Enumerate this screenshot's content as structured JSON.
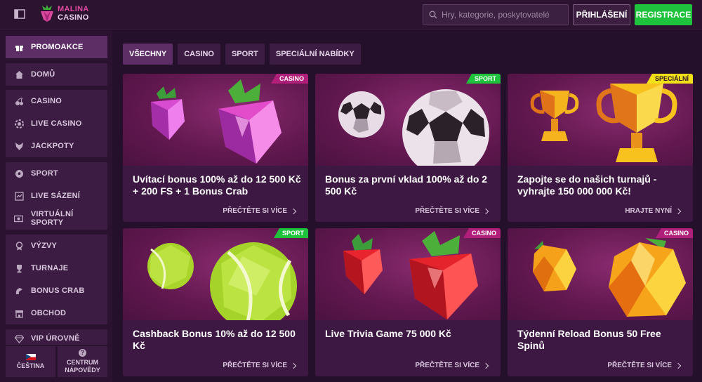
{
  "header": {
    "logo_line1": "MALINA",
    "logo_line2": "CASINO",
    "search_placeholder": "Hry, kategorie, poskytovatelé",
    "login_label": "PŘIHLÁŠENÍ",
    "register_label": "REGISTRACE"
  },
  "sidebar": {
    "groups": [
      {
        "items": [
          {
            "label": "PROMOAKCE",
            "icon": "gift-icon"
          }
        ]
      },
      {
        "items": [
          {
            "label": "DOMŮ",
            "icon": "home-icon"
          }
        ]
      },
      {
        "items": [
          {
            "label": "CASINO",
            "icon": "cherries-icon"
          },
          {
            "label": "LIVE CASINO",
            "icon": "chip-icon"
          },
          {
            "label": "JACKPOTY",
            "icon": "wolf-icon"
          }
        ]
      },
      {
        "items": [
          {
            "label": "SPORT",
            "icon": "soccer-ball-icon"
          },
          {
            "label": "LIVE SÁZENÍ",
            "icon": "live-betting-icon"
          },
          {
            "label": "VIRTUÁLNÍ SPORTY",
            "icon": "virtual-sports-icon"
          }
        ]
      },
      {
        "items": [
          {
            "label": "VÝZVY",
            "icon": "medal-icon"
          },
          {
            "label": "TURNAJE",
            "icon": "trophy-icon"
          },
          {
            "label": "BONUS CRAB",
            "icon": "claw-icon"
          },
          {
            "label": "OBCHOD",
            "icon": "shop-icon"
          }
        ]
      },
      {
        "items": [
          {
            "label": "VIP ÚROVNĚ",
            "icon": "diamond-icon"
          }
        ]
      }
    ],
    "language_label": "ČEŠTINA",
    "help_line1": "CENTRUM",
    "help_line2": "NÁPOVĚDY"
  },
  "tabs": [
    {
      "label": "VŠECHNY",
      "active": true
    },
    {
      "label": "CASINO",
      "active": false
    },
    {
      "label": "SPORT",
      "active": false
    },
    {
      "label": "SPECIÁLNÍ NABÍDKY",
      "active": false
    }
  ],
  "promos": [
    {
      "badge": "CASINO",
      "badge_type": "casino",
      "title": "Uvítací bonus 100% až do 12 500 Kč + 200 FS + 1 Bonus Crab",
      "cta": "PŘEČTĚTE SI VÍCE",
      "art": "raspberry"
    },
    {
      "badge": "SPORT",
      "badge_type": "sport",
      "title": "Bonus za první vklad 100% až do 2 500 Kč",
      "cta": "PŘEČTĚTE SI VÍCE",
      "art": "soccer"
    },
    {
      "badge": "SPECIÁLNÍ",
      "badge_type": "special",
      "title": "Zapojte se do našich turnajů - vyhrajte 150 000 000 Kč!",
      "cta": "HRAJTE NYNÍ",
      "art": "trophy"
    },
    {
      "badge": "SPORT",
      "badge_type": "sport",
      "title": "Cashback Bonus 10% až do 12 500 Kč",
      "cta": "PŘEČTĚTE SI VÍCE",
      "art": "tennis"
    },
    {
      "badge": "CASINO",
      "badge_type": "casino",
      "title": "Live Trivia Game 75 000 Kč",
      "cta": "PŘEČTĚTE SI VÍCE",
      "art": "strawberry"
    },
    {
      "badge": "CASINO",
      "badge_type": "casino",
      "title": "Týdenní Reload Bonus 50 Free Spinů",
      "cta": "PŘEČTĚTE SI VÍCE",
      "art": "lemon"
    }
  ]
}
